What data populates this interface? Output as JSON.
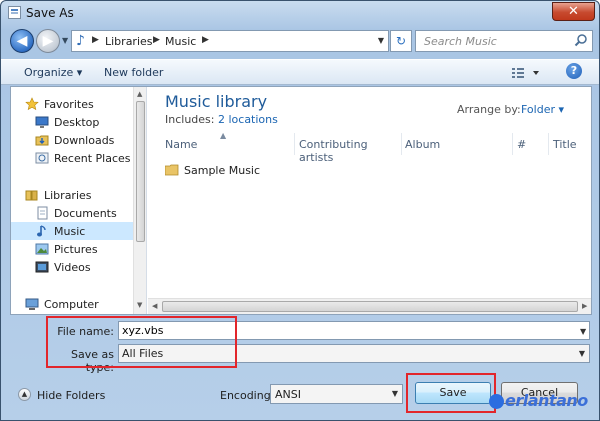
{
  "window": {
    "title": "Save As",
    "close_glyph": "✕"
  },
  "nav": {
    "back_glyph": "◀",
    "forward_glyph": "▶",
    "breadcrumbs": [
      "Libraries",
      "Music"
    ],
    "search_placeholder": "Search Music"
  },
  "toolbar": {
    "organize_label": "Organize ▾",
    "new_folder_label": "New folder",
    "help_glyph": "?"
  },
  "sidebar": {
    "items": [
      {
        "label": "Favorites",
        "icon": "star-icon"
      },
      {
        "label": "Desktop",
        "icon": "desktop-icon"
      },
      {
        "label": "Downloads",
        "icon": "downloads-icon"
      },
      {
        "label": "Recent Places",
        "icon": "recent-places-icon"
      },
      {
        "label": "Libraries",
        "icon": "libraries-icon"
      },
      {
        "label": "Documents",
        "icon": "documents-icon"
      },
      {
        "label": "Music",
        "icon": "music-icon",
        "selected": true
      },
      {
        "label": "Pictures",
        "icon": "pictures-icon"
      },
      {
        "label": "Videos",
        "icon": "videos-icon"
      },
      {
        "label": "Computer",
        "icon": "computer-icon"
      }
    ]
  },
  "content": {
    "library_title": "Music library",
    "includes_label": "Includes:",
    "includes_link": "2 locations",
    "arrange_label": "Arrange by:",
    "arrange_value": "Folder ▾",
    "columns": [
      "Name",
      "Contributing artists",
      "Album",
      "#",
      "Title"
    ],
    "files": [
      {
        "name": "Sample Music",
        "type": "folder"
      }
    ]
  },
  "form": {
    "filename_label": "File name:",
    "filename_value": "xyz.vbs",
    "filetype_label": "Save as type:",
    "filetype_value": "All Files",
    "encoding_label": "Encoding:",
    "encoding_value": "ANSI"
  },
  "footer": {
    "hide_folders_label": "Hide Folders",
    "save_label": "Save",
    "cancel_label": "Cancel"
  },
  "watermark": {
    "text": "erlantano"
  },
  "colors": {
    "highlight_red": "#e2262b",
    "selected_bg": "#cce8ff",
    "link_blue": "#1b65b2"
  }
}
